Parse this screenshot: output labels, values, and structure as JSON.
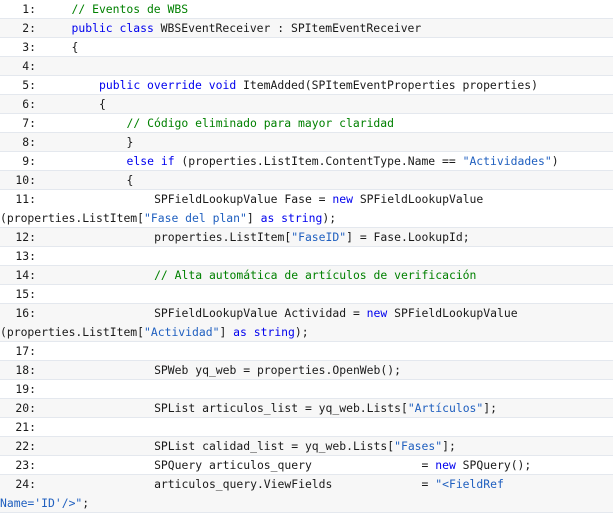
{
  "lines": [
    {
      "n": "1:",
      "indent": 4,
      "wrap": false,
      "tokens": [
        {
          "t": "// Eventos de WBS",
          "c": "cmt"
        }
      ]
    },
    {
      "n": "2:",
      "indent": 4,
      "wrap": false,
      "tokens": [
        {
          "t": "public class",
          "c": "kw"
        },
        {
          "t": " WBSEventReceiver : SPItemEventReceiver",
          "c": "pl"
        }
      ]
    },
    {
      "n": "3:",
      "indent": 4,
      "wrap": false,
      "tokens": [
        {
          "t": "{",
          "c": "pl"
        }
      ]
    },
    {
      "n": "4:",
      "indent": 0,
      "wrap": false,
      "tokens": []
    },
    {
      "n": "5:",
      "indent": 8,
      "wrap": false,
      "tokens": [
        {
          "t": "public override void",
          "c": "kw"
        },
        {
          "t": " ItemAdded(SPItemEventProperties properties)",
          "c": "pl"
        }
      ]
    },
    {
      "n": "6:",
      "indent": 8,
      "wrap": false,
      "tokens": [
        {
          "t": "{",
          "c": "pl"
        }
      ]
    },
    {
      "n": "7:",
      "indent": 12,
      "wrap": false,
      "tokens": [
        {
          "t": "// Código eliminado para mayor claridad",
          "c": "cmt"
        }
      ]
    },
    {
      "n": "8:",
      "indent": 12,
      "wrap": false,
      "tokens": [
        {
          "t": "}",
          "c": "pl"
        }
      ]
    },
    {
      "n": "9:",
      "indent": 12,
      "wrap": false,
      "tokens": [
        {
          "t": "else if",
          "c": "kw"
        },
        {
          "t": " (properties.ListItem.ContentType.Name == ",
          "c": "pl"
        },
        {
          "t": "\"Actividades\"",
          "c": "str"
        },
        {
          "t": ")",
          "c": "pl"
        }
      ]
    },
    {
      "n": "10:",
      "indent": 12,
      "wrap": false,
      "tokens": [
        {
          "t": "{",
          "c": "pl"
        }
      ]
    },
    {
      "n": "11:",
      "indent": 16,
      "wrap": true,
      "tokens": [
        {
          "t": "SPFieldLookupValue Fase = ",
          "c": "pl"
        },
        {
          "t": "new",
          "c": "kw"
        },
        {
          "t": " SPFieldLookupValue",
          "c": "pl"
        }
      ],
      "wrap_tokens": [
        {
          "t": "(properties.ListItem[",
          "c": "pl"
        },
        {
          "t": "\"Fase del plan\"",
          "c": "str"
        },
        {
          "t": "] ",
          "c": "pl"
        },
        {
          "t": "as string",
          "c": "kw"
        },
        {
          "t": ");",
          "c": "pl"
        }
      ]
    },
    {
      "n": "12:",
      "indent": 16,
      "wrap": false,
      "tokens": [
        {
          "t": "properties.ListItem[",
          "c": "pl"
        },
        {
          "t": "\"FaseID\"",
          "c": "str"
        },
        {
          "t": "] = Fase.LookupId;",
          "c": "pl"
        }
      ]
    },
    {
      "n": "13:",
      "indent": 0,
      "wrap": false,
      "tokens": []
    },
    {
      "n": "14:",
      "indent": 16,
      "wrap": false,
      "tokens": [
        {
          "t": "// Alta automática de artículos de verificación",
          "c": "cmt"
        }
      ]
    },
    {
      "n": "15:",
      "indent": 0,
      "wrap": false,
      "tokens": []
    },
    {
      "n": "16:",
      "indent": 16,
      "wrap": true,
      "tokens": [
        {
          "t": "SPFieldLookupValue Actividad = ",
          "c": "pl"
        },
        {
          "t": "new",
          "c": "kw"
        },
        {
          "t": " SPFieldLookupValue",
          "c": "pl"
        }
      ],
      "wrap_tokens": [
        {
          "t": "(properties.ListItem[",
          "c": "pl"
        },
        {
          "t": "\"Actividad\"",
          "c": "str"
        },
        {
          "t": "] ",
          "c": "pl"
        },
        {
          "t": "as string",
          "c": "kw"
        },
        {
          "t": ");",
          "c": "pl"
        }
      ]
    },
    {
      "n": "17:",
      "indent": 0,
      "wrap": false,
      "tokens": []
    },
    {
      "n": "18:",
      "indent": 16,
      "wrap": false,
      "tokens": [
        {
          "t": "SPWeb yq_web = properties.OpenWeb();",
          "c": "pl"
        }
      ]
    },
    {
      "n": "19:",
      "indent": 0,
      "wrap": false,
      "tokens": []
    },
    {
      "n": "20:",
      "indent": 16,
      "wrap": false,
      "tokens": [
        {
          "t": "SPList articulos_list = yq_web.Lists[",
          "c": "pl"
        },
        {
          "t": "\"Artículos\"",
          "c": "str"
        },
        {
          "t": "];",
          "c": "pl"
        }
      ]
    },
    {
      "n": "21:",
      "indent": 0,
      "wrap": false,
      "tokens": []
    },
    {
      "n": "22:",
      "indent": 16,
      "wrap": false,
      "tokens": [
        {
          "t": "SPList calidad_list = yq_web.Lists[",
          "c": "pl"
        },
        {
          "t": "\"Fases\"",
          "c": "str"
        },
        {
          "t": "];",
          "c": "pl"
        }
      ]
    },
    {
      "n": "23:",
      "indent": 16,
      "wrap": false,
      "tokens": [
        {
          "t": "SPQuery articulos_query                = ",
          "c": "pl"
        },
        {
          "t": "new",
          "c": "kw"
        },
        {
          "t": " SPQuery();",
          "c": "pl"
        }
      ]
    },
    {
      "n": "24:",
      "indent": 16,
      "wrap": true,
      "tokens": [
        {
          "t": "articulos_query.ViewFields             = ",
          "c": "pl"
        },
        {
          "t": "\"<FieldRef",
          "c": "str"
        }
      ],
      "wrap_tokens": [
        {
          "t": "Name='ID'/>\"",
          "c": "str"
        },
        {
          "t": ";",
          "c": "pl"
        }
      ]
    }
  ]
}
